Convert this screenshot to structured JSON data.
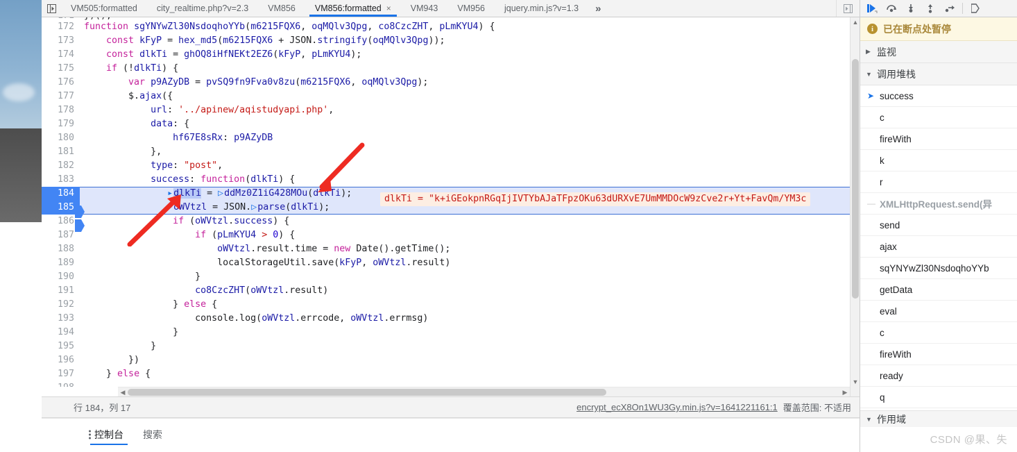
{
  "tabs": [
    {
      "label": "VM505:formatted",
      "active": false,
      "closable": false
    },
    {
      "label": "city_realtime.php?v=2.3",
      "active": false,
      "closable": false
    },
    {
      "label": "VM856",
      "active": false,
      "closable": false
    },
    {
      "label": "VM856:formatted",
      "active": true,
      "closable": true
    },
    {
      "label": "VM943",
      "active": false,
      "closable": false
    },
    {
      "label": "VM956",
      "active": false,
      "closable": false
    },
    {
      "label": "jquery.min.js?v=1.3",
      "active": false,
      "closable": false
    }
  ],
  "tab_more_label": "»",
  "tab_close_glyph": "×",
  "editor": {
    "first_partial_line": {
      "num": "171",
      "text": "})();"
    },
    "lines": [
      {
        "num": "172",
        "indent": 0
      },
      {
        "num": "173",
        "indent": 0
      },
      {
        "num": "174",
        "indent": 0
      },
      {
        "num": "175",
        "indent": 0
      },
      {
        "num": "176",
        "indent": 0
      },
      {
        "num": "177",
        "indent": 0
      },
      {
        "num": "178",
        "indent": 0
      },
      {
        "num": "179",
        "indent": 0
      },
      {
        "num": "180",
        "indent": 0
      },
      {
        "num": "181",
        "indent": 0
      },
      {
        "num": "182",
        "indent": 0
      },
      {
        "num": "183",
        "indent": 0
      },
      {
        "num": "184",
        "indent": 0
      },
      {
        "num": "185",
        "indent": 0
      },
      {
        "num": "186",
        "indent": 0
      },
      {
        "num": "187",
        "indent": 0
      },
      {
        "num": "188",
        "indent": 0
      },
      {
        "num": "189",
        "indent": 0
      },
      {
        "num": "190",
        "indent": 0
      },
      {
        "num": "191",
        "indent": 0
      },
      {
        "num": "192",
        "indent": 0
      },
      {
        "num": "193",
        "indent": 0
      },
      {
        "num": "194",
        "indent": 0
      },
      {
        "num": "195",
        "indent": 0
      },
      {
        "num": "196",
        "indent": 0
      },
      {
        "num": "197",
        "indent": 0
      },
      {
        "num": "198",
        "indent": 0
      }
    ],
    "code_text": {
      "l172": "function sgYNYwZl30NsdoqhoYYb(m6215FQX6, oqMQlv3Qpg, co8CzcZHT, pLmKYU4) {",
      "l173": "    const kFyP = hex_md5(m6215FQX6 + JSON.stringify(oqMQlv3Qpg));",
      "l174": "    const dlkTi = ghOQ8iHfNEKt2EZ6(kFyP, pLmKYU4);",
      "l175": "    if (!dlkTi) {",
      "l176": "        var p9AZyDB = pvSQ9fn9Fva0v8zu(m6215FQX6, oqMQlv3Qpg);",
      "l177": "        $.ajax({",
      "l178": "            url: '../apinew/aqistudyapi.php',",
      "l179": "            data: {",
      "l180": "                hf67E8sRx: p9AZyDB",
      "l181": "            },",
      "l182": "            type: \"post\",",
      "l183": "            success: function(dlkTi) {",
      "l184": "                dlkTi = ddMz0Z1iG428MOu(dlkTi);",
      "l185": "                oWVtzl = JSON.parse(dlkTi);",
      "l186": "                if (oWVtzl.success) {",
      "l187": "                    if (pLmKYU4 > 0) {",
      "l188": "                        oWVtzl.result.time = new Date().getTime();",
      "l189": "                        localStorageUtil.save(kFyP, oWVtzl.result)",
      "l190": "                    }",
      "l191": "                    co8CzcZHT(oWVtzl.result)",
      "l192": "                } else {",
      "l193": "                    console.log(oWVtzl.errcode, oWVtzl.errmsg)",
      "l194": "                }",
      "l195": "            }",
      "l196": "        })",
      "l197": "    } else {",
      "l198": ""
    },
    "inline_value_popup": "dlkTi = \"k+iGEokpnRGqIjIVTYbAJaTFpzOKu63dURXvE7UmMMDOcW9zCve2r+Yt+FavQm/YM3c",
    "selected_token": "dlkTi",
    "highlighted_lines": [
      "184",
      "185"
    ]
  },
  "statusbar": {
    "position_text": "行 184，列 17",
    "source_link": "encrypt_ecX8On1WU3Gy.min.js?v=1641221161:1",
    "coverage_text": "覆盖范围: 不适用"
  },
  "drawer": {
    "tabs": [
      {
        "label": "控制台",
        "active": true
      },
      {
        "label": "搜索",
        "active": false
      }
    ]
  },
  "sidebar": {
    "toolbar_icons": [
      "resume-script-icon",
      "step-over-icon",
      "step-into-icon",
      "step-out-icon",
      "step-icon",
      "deactivate-breakpoints-icon"
    ],
    "pause_banner": "已在断点处暂停",
    "pause_icon_glyph": "i",
    "sections": {
      "watch": {
        "label": "监视",
        "expanded": false
      },
      "call_stack": {
        "label": "调用堆栈",
        "expanded": true
      },
      "scope": {
        "label": "作用域",
        "expanded": true
      }
    },
    "call_stack": [
      {
        "label": "success",
        "current": true,
        "async": false
      },
      {
        "label": "c",
        "current": false,
        "async": false
      },
      {
        "label": "fireWith",
        "current": false,
        "async": false
      },
      {
        "label": "k",
        "current": false,
        "async": false
      },
      {
        "label": "r",
        "current": false,
        "async": false
      },
      {
        "label": "XMLHttpRequest.send(异",
        "current": false,
        "async": true
      },
      {
        "label": "send",
        "current": false,
        "async": false
      },
      {
        "label": "ajax",
        "current": false,
        "async": false
      },
      {
        "label": "sqYNYwZl30NsdoqhoYYb",
        "current": false,
        "async": false
      },
      {
        "label": "getData",
        "current": false,
        "async": false
      },
      {
        "label": "eval",
        "current": false,
        "async": false
      },
      {
        "label": "c",
        "current": false,
        "async": false
      },
      {
        "label": "fireWith",
        "current": false,
        "async": false
      },
      {
        "label": "ready",
        "current": false,
        "async": false
      },
      {
        "label": "q",
        "current": false,
        "async": false
      }
    ]
  },
  "watermark": "CSDN @果、失",
  "colors": {
    "accent_blue": "#1a73e8",
    "highlight_row": "#dfe6fb",
    "gutter_active": "#4285f4",
    "popup_bg": "#fdeee3",
    "popup_text": "#c41a16",
    "pause_banner_bg": "#fdf8e3",
    "annotation_red": "#ee2b22"
  }
}
